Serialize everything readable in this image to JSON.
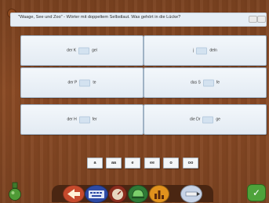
{
  "instruction": {
    "text": "\"Waage, See und Zoo\" - Wörter mit doppeltem Selbstlaut. Was gehört in die Lücke?"
  },
  "cards": [
    {
      "pre": "der K",
      "post": "gel"
    },
    {
      "pre": "j",
      "post": "deln"
    },
    {
      "pre": "der P",
      "post": "te"
    },
    {
      "pre": "das S",
      "post": "fe"
    },
    {
      "pre": "der H",
      "post": "fer"
    },
    {
      "pre": "die Dr",
      "post": "ge"
    }
  ],
  "choices": [
    "a",
    "aa",
    "e",
    "ee",
    "o",
    "oo"
  ],
  "colors": {
    "wood": "#7a4220",
    "card": "#e9eff6",
    "slot": "#d3e2f0",
    "check": "#4ea33b"
  },
  "toolbar": {
    "icons": [
      "back-arrow-icon",
      "keyboard-icon",
      "meter-icon",
      "helmet-icon",
      "chart-icon",
      "pencil-icon"
    ],
    "check_icon": "check-icon"
  }
}
